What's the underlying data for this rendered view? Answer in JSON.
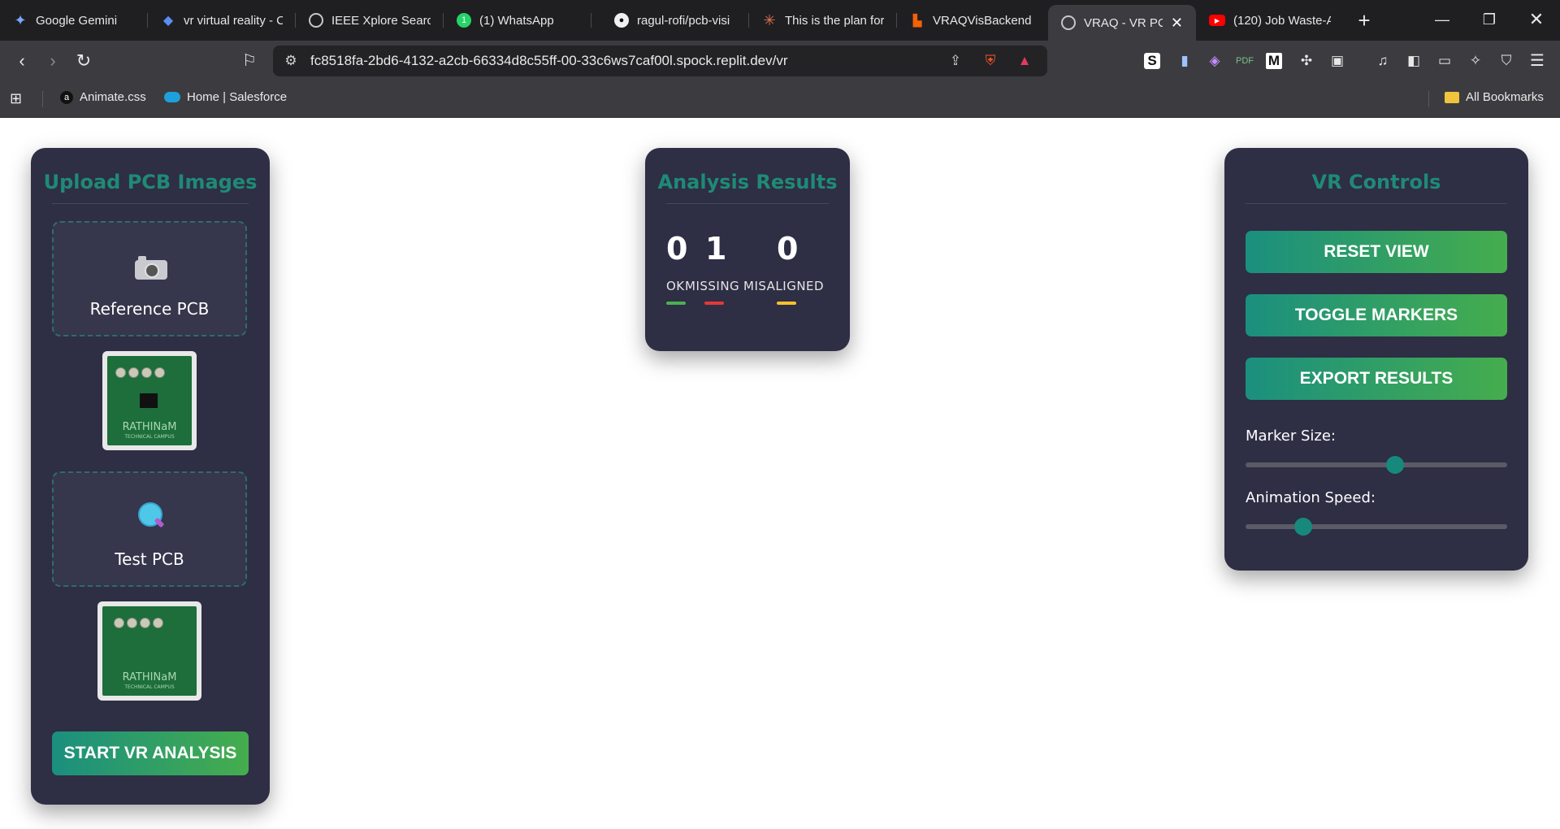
{
  "browser": {
    "tabs": [
      {
        "label": "Google Gemini",
        "icon": "gemini-icon"
      },
      {
        "label": "vr virtual reality - C",
        "icon": "diamond-icon"
      },
      {
        "label": "IEEE Xplore Search",
        "icon": "globe-icon"
      },
      {
        "label": "(1) WhatsApp",
        "icon": "whatsapp-icon"
      },
      {
        "label": "ragul-rofi/pcb-visi",
        "icon": "github-icon"
      },
      {
        "label": "This is the plan for",
        "icon": "claude-icon"
      },
      {
        "label": "VRAQVisBackend -",
        "icon": "replit-icon"
      },
      {
        "label": "VRAQ - VR PC",
        "icon": "globe-icon",
        "active": true
      },
      {
        "label": "(120) Job Waste-A",
        "icon": "youtube-icon"
      }
    ],
    "new_tab": "+",
    "url": "fc8518fa-2bd6-4132-a2cb-66334d8c55ff-00-33c6ws7caf00l.spock.replit.dev/vr",
    "bookmarks": [
      {
        "label": "Animate.css",
        "icon": "amazon-icon"
      },
      {
        "label": "Home | Salesforce",
        "icon": "salesforce-icon"
      }
    ],
    "all_bookmarks": "All Bookmarks"
  },
  "upload_panel": {
    "title": "Upload PCB Images",
    "reference_label": "Reference PCB",
    "test_label": "Test PCB",
    "pcb_text_main": "RATHINaM",
    "pcb_text_sub": "TECHNICAL CAMPUS",
    "start_button": "START VR ANALYSIS"
  },
  "results_panel": {
    "title": "Analysis Results",
    "stats": [
      {
        "value": "0",
        "label": "OK",
        "color": "#4caf50"
      },
      {
        "value": "1",
        "label": "MISSING",
        "color": "#e53935"
      },
      {
        "value": "0",
        "label": "MISALIGNED",
        "color": "#fbc02d"
      }
    ]
  },
  "vr_controls": {
    "title": "VR Controls",
    "buttons": [
      "RESET VIEW",
      "TOGGLE MARKERS",
      "EXPORT RESULTS"
    ],
    "marker_size_label": "Marker Size:",
    "marker_size_value": 0.57,
    "animation_speed_label": "Animation Speed:",
    "animation_speed_value": 0.22
  },
  "colors": {
    "panel_bg": "#2e2e45",
    "accent": "#1f8a76",
    "button_gradient_start": "#1b8f7f",
    "button_gradient_end": "#45ad4d"
  }
}
